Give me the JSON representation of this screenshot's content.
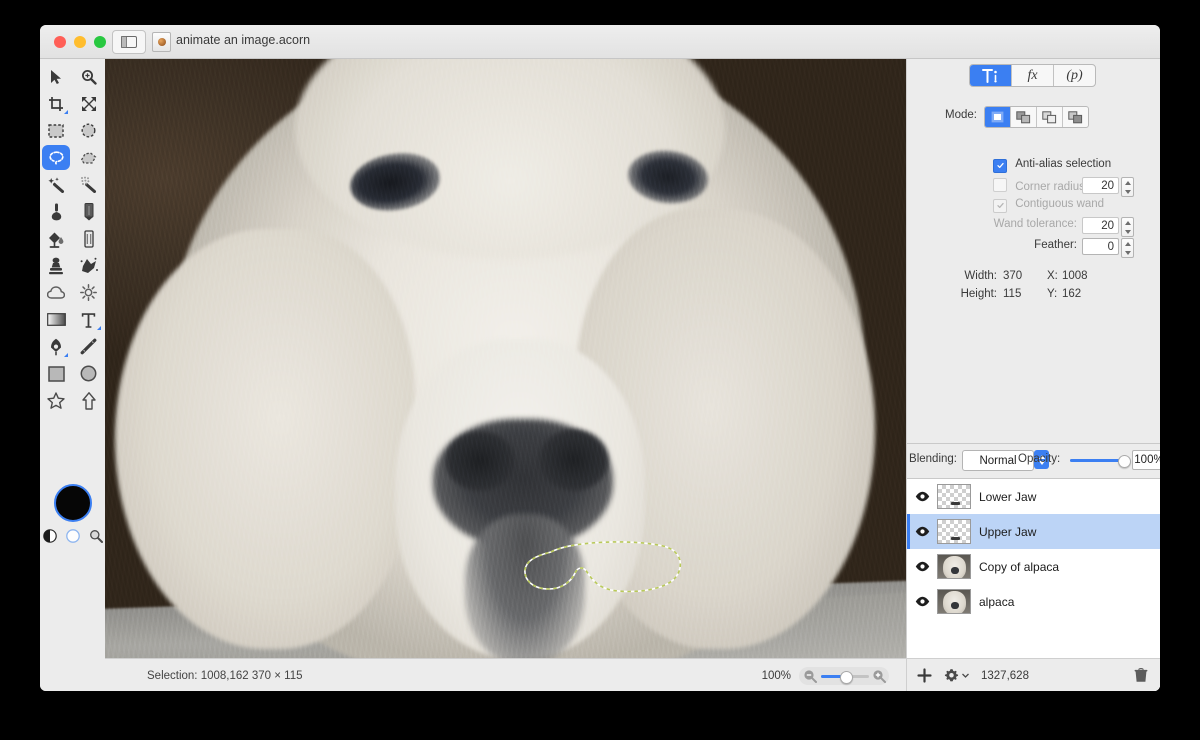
{
  "window": {
    "title": "animate an image.acorn",
    "traffic_lights": [
      "close",
      "minimize",
      "zoom"
    ],
    "sidebar_toggle_icon": "sidebar-icon",
    "document_icon": "acorn-document-icon"
  },
  "tools": {
    "items": [
      {
        "name": "move-tool",
        "icon": "arrow-cursor-icon",
        "selected": false
      },
      {
        "name": "zoom-tool",
        "icon": "magnifier-plus-icon",
        "selected": false
      },
      {
        "name": "crop-tool",
        "icon": "crop-icon",
        "selected": false,
        "has_submenu": true
      },
      {
        "name": "transform-tool",
        "icon": "move-arrows-icon",
        "selected": false
      },
      {
        "name": "rectangle-select-tool",
        "icon": "marquee-rect-icon",
        "selected": false
      },
      {
        "name": "ellipse-select-tool",
        "icon": "marquee-ellipse-icon",
        "selected": false
      },
      {
        "name": "lasso-select-tool",
        "icon": "lasso-icon",
        "selected": true
      },
      {
        "name": "polygon-lasso-tool",
        "icon": "polygon-lasso-icon",
        "selected": false
      },
      {
        "name": "magic-wand-tool",
        "icon": "magic-wand-icon",
        "selected": false
      },
      {
        "name": "instant-alpha-tool",
        "icon": "magic-wand-dots-icon",
        "selected": false
      },
      {
        "name": "brush-tool",
        "icon": "brush-icon",
        "selected": false
      },
      {
        "name": "pencil-tool",
        "icon": "pencil-icon",
        "selected": false
      },
      {
        "name": "paint-bucket-tool",
        "icon": "paint-bucket-icon",
        "selected": false
      },
      {
        "name": "eraser-tool",
        "icon": "eraser-icon",
        "selected": false
      },
      {
        "name": "clone-stamp-tool",
        "icon": "stamp-icon",
        "selected": false
      },
      {
        "name": "smudge-tool",
        "icon": "smudge-icon",
        "selected": false
      },
      {
        "name": "blur-tool",
        "icon": "cloud-icon",
        "selected": false
      },
      {
        "name": "dodge-tool",
        "icon": "sun-icon",
        "selected": false
      },
      {
        "name": "gradient-tool",
        "icon": "gradient-icon",
        "selected": false
      },
      {
        "name": "text-tool",
        "icon": "text-t-icon",
        "selected": false,
        "has_submenu": true
      },
      {
        "name": "bezier-tool",
        "icon": "pen-nib-icon",
        "selected": false,
        "has_submenu": true
      },
      {
        "name": "line-tool",
        "icon": "line-icon",
        "selected": false
      },
      {
        "name": "rectangle-shape-tool",
        "icon": "square-icon",
        "selected": false
      },
      {
        "name": "ellipse-shape-tool",
        "icon": "circle-icon",
        "selected": false
      },
      {
        "name": "star-shape-tool",
        "icon": "star-icon",
        "selected": false
      },
      {
        "name": "arrow-shape-tool",
        "icon": "arrow-up-icon",
        "selected": false
      }
    ],
    "color_swatch": {
      "name": "foreground-color-swatch",
      "color": "#060606",
      "ring_color": "#3b7ff2"
    },
    "swatch_row": [
      {
        "name": "invert-colors-icon",
        "icon": "half-filled-circle-icon"
      },
      {
        "name": "transparent-color-icon",
        "icon": "empty-circle-icon"
      },
      {
        "name": "color-picker-icon",
        "icon": "magnifier-icon"
      }
    ]
  },
  "inspector": {
    "tabs": [
      {
        "label": "",
        "icon": "tool-options-icon",
        "name": "tab-tool-options",
        "selected": true
      },
      {
        "label": "fx",
        "icon": "",
        "name": "tab-filters",
        "selected": false
      },
      {
        "label": "(p)",
        "icon": "",
        "name": "tab-palette",
        "selected": false
      }
    ],
    "mode_label": "Mode:",
    "modes": [
      {
        "name": "mode-new-selection",
        "icon": "new-selection-icon",
        "selected": true
      },
      {
        "name": "mode-add-selection",
        "icon": "add-selection-icon",
        "selected": false
      },
      {
        "name": "mode-subtract-selection",
        "icon": "subtract-selection-icon",
        "selected": false
      },
      {
        "name": "mode-intersect-selection",
        "icon": "intersect-selection-icon",
        "selected": false
      }
    ],
    "antialias": {
      "label": "Anti-alias selection",
      "checked": true,
      "enabled": true
    },
    "corner_radius": {
      "label": "Corner radius:",
      "checked": false,
      "value": "20",
      "enabled": false
    },
    "contiguous_wand": {
      "label": "Contiguous wand",
      "checked": true,
      "enabled": false
    },
    "wand_tolerance": {
      "label": "Wand tolerance:",
      "value": "20",
      "enabled": false
    },
    "feather": {
      "label": "Feather:",
      "value": "0",
      "enabled": true
    },
    "metrics": {
      "width_label": "Width:",
      "width_value": "370",
      "height_label": "Height:",
      "height_value": "115",
      "x_label": "X:",
      "x_value": "1008",
      "y_label": "Y:",
      "y_value": "162"
    }
  },
  "layers_panel": {
    "blending_label": "Blending:",
    "blending_value": "Normal",
    "opacity_label": "Opacity:",
    "opacity_value": "100%",
    "opacity_percent": 100,
    "layers": [
      {
        "name": "Lower Jaw",
        "visible": true,
        "selected": false,
        "thumb": "transparent"
      },
      {
        "name": "Upper Jaw",
        "visible": true,
        "selected": true,
        "thumb": "transparent"
      },
      {
        "name": "Copy of alpaca",
        "visible": true,
        "selected": false,
        "thumb": "photo"
      },
      {
        "name": "alpaca",
        "visible": true,
        "selected": false,
        "thumb": "photo"
      }
    ],
    "footer": {
      "add_layer_icon": "plus-icon",
      "settings_icon": "gear-icon",
      "coords": "1327,628",
      "delete_icon": "trash-icon"
    }
  },
  "status": {
    "selection_text": "Selection: 1008,162 370 × 115",
    "zoom_label": "100%",
    "zoom_out_icon": "magnifier-minus-icon",
    "zoom_in_icon": "magnifier-plus-icon",
    "zoom_percent": 50
  },
  "canvas": {
    "subject": "alpaca-photograph",
    "selection_shape": "lasso-marching-ants-outline"
  },
  "colors": {
    "accent": "#3b7ff2",
    "chrome": "#ececec",
    "selection_row": "#bcd4f6",
    "marching_ants": "#c9d66a"
  }
}
